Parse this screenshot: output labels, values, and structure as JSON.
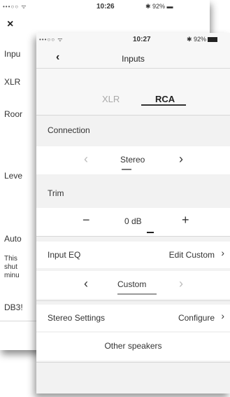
{
  "back": {
    "status": {
      "signal": "•••○○ ᯤ",
      "time": "10:26",
      "battery": "✱ 92% ▬"
    },
    "close_icon": "×",
    "rows": [
      "Inpu",
      "XLR",
      "Roor",
      "Leve",
      "Auto",
      "This shut minu",
      "DB3!"
    ]
  },
  "front": {
    "status": {
      "signal": "•••○○ ᯤ",
      "time": "10:27",
      "battery": "✱ 92%"
    },
    "nav": {
      "back_icon": "‹",
      "title": "Inputs"
    },
    "tabs": {
      "xlr": "XLR",
      "rca": "RCA"
    },
    "connection": {
      "label": "Connection",
      "value": "Stereo",
      "left": "‹",
      "right": "›"
    },
    "trim": {
      "label": "Trim",
      "value": "0 dB",
      "minus": "−",
      "plus": "+"
    },
    "input_eq": {
      "label": "Input EQ",
      "action": "Edit Custom",
      "chevron": "›",
      "value": "Custom",
      "left": "‹",
      "right": "›"
    },
    "stereo": {
      "label": "Stereo Settings",
      "action": "Configure",
      "chevron": "›",
      "other": "Other speakers"
    }
  }
}
